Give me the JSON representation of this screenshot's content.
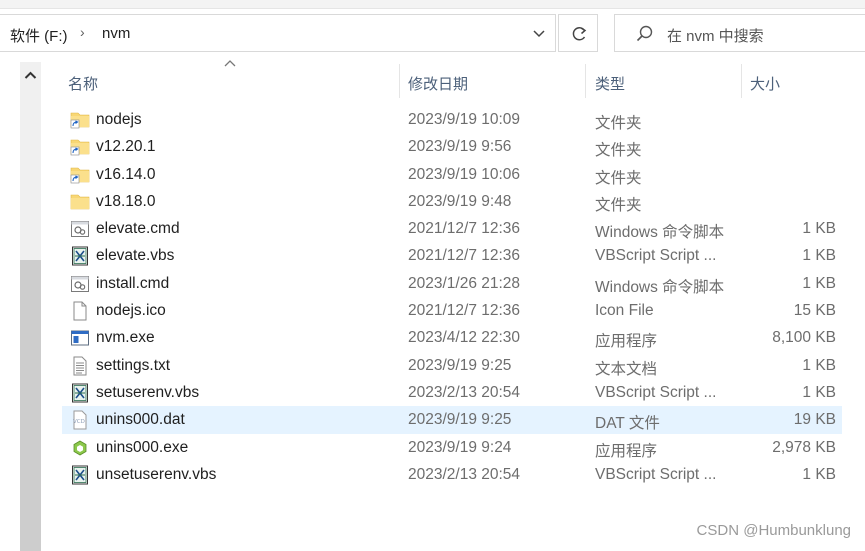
{
  "address": {
    "root": "软件 (F:)",
    "separator": "›",
    "current": "nvm"
  },
  "search": {
    "placeholder": "在 nvm 中搜索"
  },
  "columns": {
    "name": "名称",
    "modified": "修改日期",
    "type": "类型",
    "size": "大小"
  },
  "files": [
    {
      "name": "nodejs",
      "modified": "2023/9/19 10:09",
      "type": "文件夹",
      "size": "",
      "icon": "folder-shortcut-icon"
    },
    {
      "name": "v12.20.1",
      "modified": "2023/9/19 9:56",
      "type": "文件夹",
      "size": "",
      "icon": "folder-shortcut-icon"
    },
    {
      "name": "v16.14.0",
      "modified": "2023/9/19 10:06",
      "type": "文件夹",
      "size": "",
      "icon": "folder-shortcut-icon"
    },
    {
      "name": "v18.18.0",
      "modified": "2023/9/19 9:48",
      "type": "文件夹",
      "size": "",
      "icon": "folder-icon"
    },
    {
      "name": "elevate.cmd",
      "modified": "2021/12/7 12:36",
      "type": "Windows 命令脚本",
      "size": "1 KB",
      "icon": "cmd-file-icon"
    },
    {
      "name": "elevate.vbs",
      "modified": "2021/12/7 12:36",
      "type": "VBScript Script ...",
      "size": "1 KB",
      "icon": "vbs-file-icon"
    },
    {
      "name": "install.cmd",
      "modified": "2023/1/26 21:28",
      "type": "Windows 命令脚本",
      "size": "1 KB",
      "icon": "cmd-file-icon"
    },
    {
      "name": "nodejs.ico",
      "modified": "2021/12/7 12:36",
      "type": "Icon File",
      "size": "15 KB",
      "icon": "blank-file-icon"
    },
    {
      "name": "nvm.exe",
      "modified": "2023/4/12 22:30",
      "type": "应用程序",
      "size": "8,100 KB",
      "icon": "exe-window-icon"
    },
    {
      "name": "settings.txt",
      "modified": "2023/9/19 9:25",
      "type": "文本文档",
      "size": "1 KB",
      "icon": "text-file-icon"
    },
    {
      "name": "setuserenv.vbs",
      "modified": "2023/2/13 20:54",
      "type": "VBScript Script ...",
      "size": "1 KB",
      "icon": "vbs-file-icon"
    },
    {
      "name": "unins000.dat",
      "modified": "2023/9/19 9:25",
      "type": "DAT 文件",
      "size": "19 KB",
      "icon": "dat-file-icon"
    },
    {
      "name": "unins000.exe",
      "modified": "2023/9/19 9:24",
      "type": "应用程序",
      "size": "2,978 KB",
      "icon": "uninstaller-icon"
    },
    {
      "name": "unsetuserenv.vbs",
      "modified": "2023/2/13 20:54",
      "type": "VBScript Script ...",
      "size": "1 KB",
      "icon": "vbs-file-icon"
    }
  ],
  "selected_row": 11,
  "watermark": "CSDN @Humbunklung",
  "colors": {
    "folder": "#f8d775",
    "selection": "#e5f3ff",
    "header_text": "#4c607a",
    "secondary_text": "#6d6d6d"
  }
}
